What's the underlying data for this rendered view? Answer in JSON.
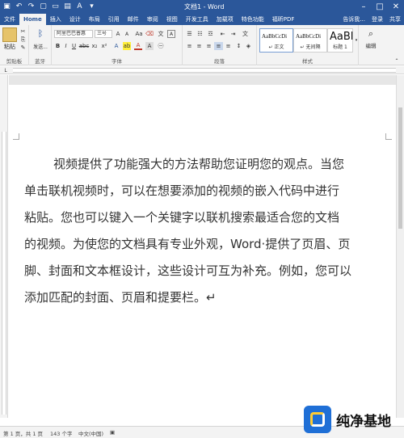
{
  "window": {
    "title": "文档1 - Word",
    "quick_access": [
      "save-icon",
      "undo-icon",
      "redo-icon",
      "new-doc-icon",
      "open-icon",
      "print-preview-icon",
      "font-color-icon"
    ],
    "controls": [
      "minimize-icon",
      "maximize-icon",
      "close-icon"
    ]
  },
  "tabs": {
    "items": [
      "文件",
      "Home",
      "插入",
      "设计",
      "布局",
      "引用",
      "邮件",
      "审阅",
      "视图",
      "开发工具",
      "加载项",
      "特色功能",
      "福昕PDF"
    ],
    "active": "Home",
    "tell_me": "告诉我...",
    "login": "登录",
    "share": "共享"
  },
  "ribbon": {
    "clipboard": {
      "label": "剪贴板",
      "paste": "粘贴"
    },
    "bluetooth": {
      "label": "蓝牙",
      "send": "发送..."
    },
    "font": {
      "label": "字体",
      "font_name": "阿里巴巴普惠",
      "font_size": "三号"
    },
    "paragraph": {
      "label": "段落"
    },
    "styles": {
      "label": "样式",
      "cards": [
        {
          "sample": "AaBbCcDi",
          "name": "↵ 正文"
        },
        {
          "sample": "AaBbCcDi",
          "name": "↵ 无间隔"
        },
        {
          "sample": "AaBl",
          "name": "标题 1"
        }
      ]
    },
    "editing": {
      "label": "编辑"
    }
  },
  "document": {
    "lines": [
      "视频提供了功能强大的方法帮助您证明您的观点。当您",
      "单击联机视频时，可以在想要添加的视频的嵌入代码中进行",
      "粘贴。您也可以键入一个关键字以联机搜索最适合您的文档",
      "的视频。为使您的文档具有专业外观，Word·提供了页眉、页",
      "脚、封面和文本框设计，这些设计可互为补充。例如，您可以",
      "添加匹配的封面、页眉和提要栏。↵"
    ]
  },
  "status": {
    "page": "第 1 页，共 1 页",
    "words": "143 个字",
    "language": "中文(中国)"
  },
  "watermark": {
    "text": "纯净基地"
  },
  "colors": {
    "word_blue": "#2b579a",
    "ribbon_bg": "#f3f3f3",
    "watermark_blue": "#1f6fd6"
  }
}
